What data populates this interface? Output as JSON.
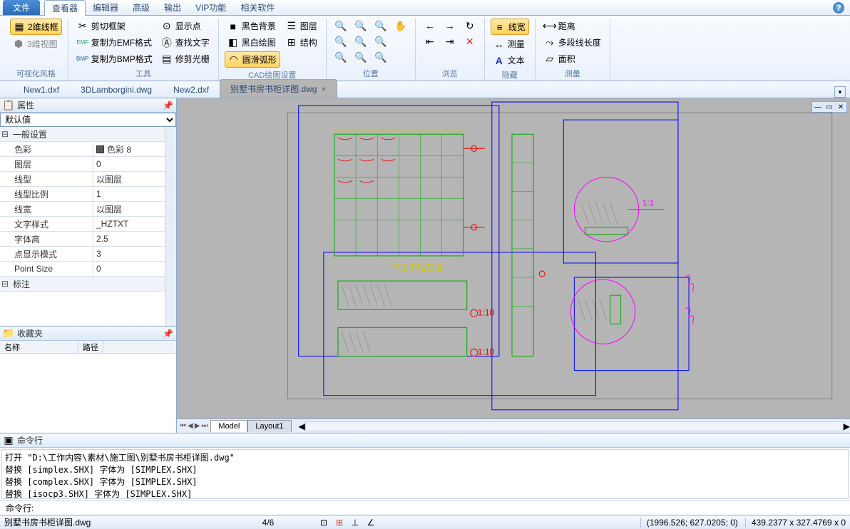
{
  "menubar": {
    "file": "文件",
    "items": [
      "查看器",
      "编辑器",
      "高级",
      "输出",
      "VIP功能",
      "相关软件"
    ],
    "active_index": 0
  },
  "ribbon": {
    "groups": [
      {
        "label": "可视化风格",
        "items": [
          {
            "txt": "2维线框",
            "active": true
          },
          {
            "txt": "3维视图"
          }
        ]
      },
      {
        "label": "工具",
        "items": [
          {
            "txt": "剪切框架"
          },
          {
            "txt": "复制为EMF格式"
          },
          {
            "txt": "复制为BMP格式"
          },
          {
            "txt": "显示点"
          },
          {
            "txt": "查找文字"
          },
          {
            "txt": "修剪光栅"
          }
        ]
      },
      {
        "label": "CAD绘图设置",
        "items": [
          {
            "txt": "黑色背景"
          },
          {
            "txt": "黑白绘图"
          },
          {
            "txt": "圆滑弧形",
            "active": true
          },
          {
            "txt": "图层"
          },
          {
            "txt": "结构"
          }
        ]
      },
      {
        "label": "位置",
        "items": []
      },
      {
        "label": "浏览",
        "items": []
      },
      {
        "label": "隐藏",
        "items": [
          {
            "txt": "线宽",
            "active": true
          },
          {
            "txt": "测量"
          },
          {
            "txt": "文本"
          }
        ]
      },
      {
        "label": "测量",
        "items": [
          {
            "txt": "距离"
          },
          {
            "txt": "多段线长度"
          },
          {
            "txt": "面积"
          }
        ]
      }
    ]
  },
  "tabs": {
    "items": [
      "New1.dxf",
      "3DLamborgini.dwg",
      "New2.dxf",
      "别墅书房书柜详图.dwg"
    ],
    "active_index": 3
  },
  "properties": {
    "title": "属性",
    "selector": "默认值",
    "section1": "一般设置",
    "rows": [
      {
        "k": "色彩",
        "v": "色彩 8",
        "swatch": true
      },
      {
        "k": "图层",
        "v": "0"
      },
      {
        "k": "线型",
        "v": "以图层"
      },
      {
        "k": "线型比例",
        "v": "1"
      },
      {
        "k": "线宽",
        "v": "以图层"
      },
      {
        "k": "文字样式",
        "v": "_HZTXT"
      },
      {
        "k": "字体高",
        "v": "2.5"
      },
      {
        "k": "点显示模式",
        "v": "3"
      },
      {
        "k": "Point Size",
        "v": "0"
      }
    ],
    "section2": "标注"
  },
  "favorites": {
    "title": "收藏夹",
    "col1": "名称",
    "col2": "路径"
  },
  "layout_tabs": {
    "model": "Model",
    "layout1": "Layout1"
  },
  "commandline": {
    "title": "命令行",
    "log": "打开 \"D:\\工作内容\\素材\\施工图\\别墅书房书柜详图.dwg\"\n替换 [simplex.SHX] 字体为 [SIMPLEX.SHX]\n替换 [complex.SHX] 字体为 [SIMPLEX.SHX]\n替换 [isocp3.SHX] 字体为 [SIMPLEX.SHX]",
    "prompt": "命令行: "
  },
  "status": {
    "file": "别墅书房书柜详图.dwg",
    "pages": "4/6",
    "coords": "(1996.526; 627.0205; 0)",
    "dims": "439.2377 x 327.4769 x 0"
  },
  "drawing": {
    "scale_labels": [
      "1:10",
      "1:1"
    ],
    "title_label": "书房书柜立面"
  }
}
